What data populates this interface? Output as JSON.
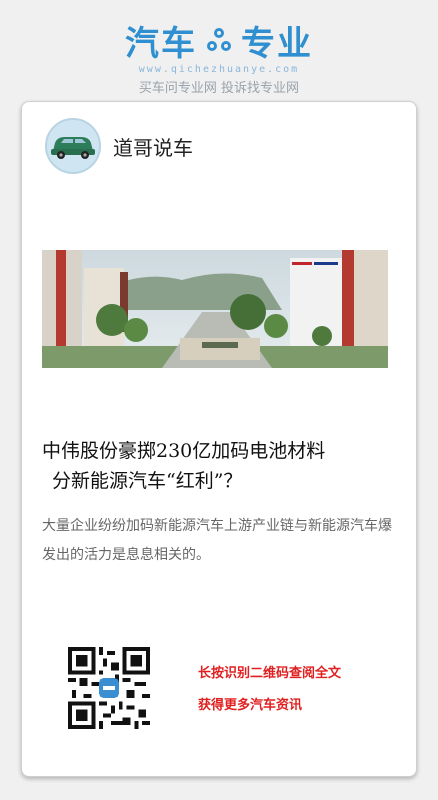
{
  "brand": {
    "title_left": "汽车",
    "title_right": "专业",
    "domain": "www.qichezhuanye.com",
    "slogan": "买车问专业网 投诉找专业网",
    "accent": "#2f8fd0"
  },
  "author": {
    "name": "道哥说车",
    "avatar_icon": "green-car-icon"
  },
  "photo": {
    "icon": "factory-gate-photo"
  },
  "article": {
    "headline_line1": "中伟股份豪掷230亿加码电池材料",
    "headline_line2": "分新能源汽车“红利”？",
    "summary": "大量企业纷纷加码新能源汽车上游产业链与新能源汽车爆发出的活力是息息相关的。"
  },
  "qr": {
    "icon": "qr-code-icon",
    "cta_line1": "长按识别二维码查阅全文",
    "cta_line2": "获得更多汽车资讯",
    "cta_color": "#e02020"
  }
}
